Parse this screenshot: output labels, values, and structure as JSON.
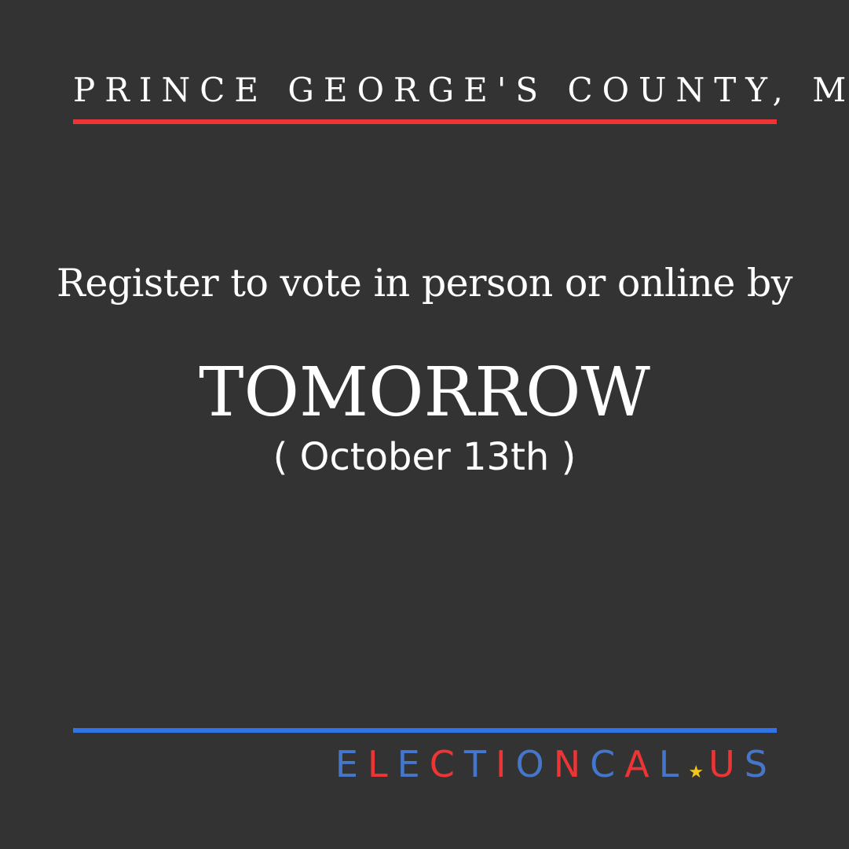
{
  "header": {
    "location": "PRINCE GEORGE'S COUNTY, MARYLAND"
  },
  "message": {
    "line": "Register to vote in person or online by",
    "deadline": "TOMORROW",
    "date": "( October 13th )"
  },
  "logo": {
    "part1": "ELECTIONCAL",
    "separator": "★",
    "part2": "US"
  },
  "colors": {
    "background": "#343333",
    "red_accent": "#ee3536",
    "blue_accent": "#2f74e8",
    "star": "#f5c518"
  }
}
